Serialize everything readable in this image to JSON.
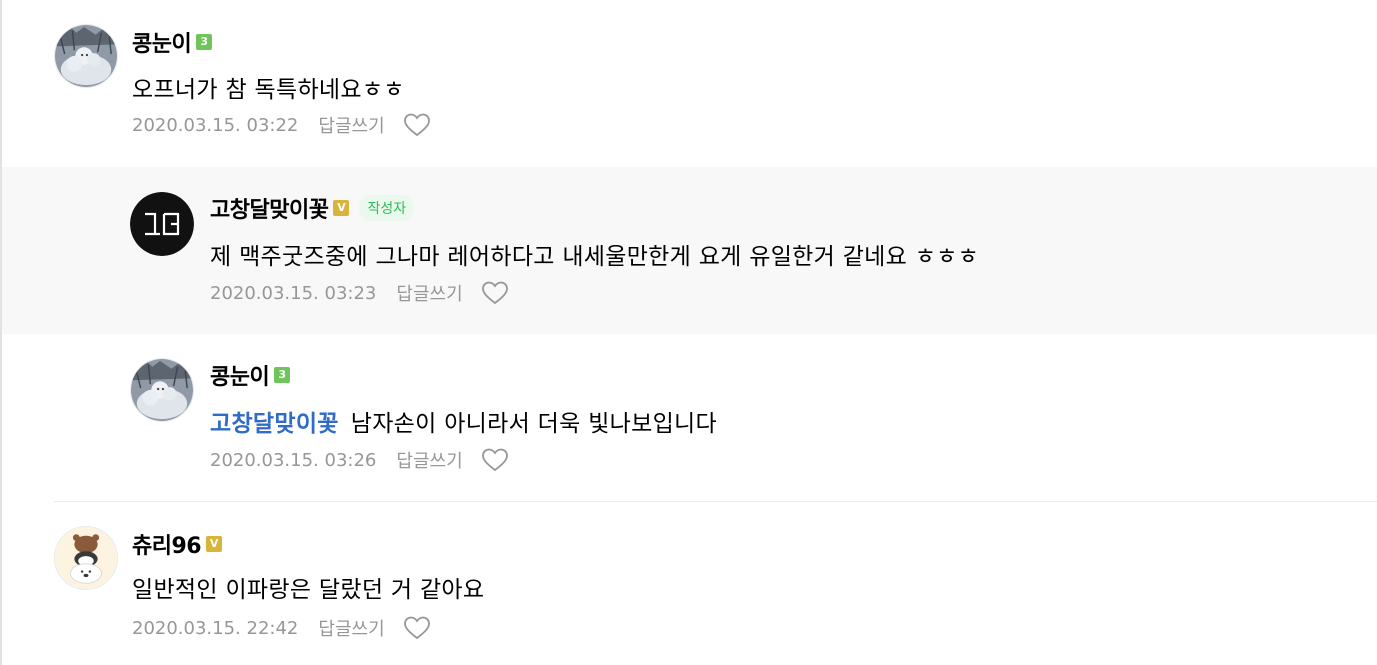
{
  "comments": [
    {
      "nickname": "콩눈이",
      "badge": "3",
      "badge_color": "#6fc45a",
      "avatar": "snowman-photo",
      "text": "오프너가 참 독특하네요ㅎㅎ",
      "timestamp": "2020.03.15. 03:22",
      "reply_label": "답글쓰기"
    },
    {
      "nickname": "고창달맞이꽃",
      "badge": "V",
      "badge_color": "#d8b43a",
      "author_tag": "작성자",
      "avatar": "gcd-logo",
      "avatar_text": "GD",
      "text": "제 맥주굿즈중에 그나마 레어하다고 내세울만한게 요게 유일한거 같네요 ㅎㅎㅎ",
      "timestamp": "2020.03.15. 03:23",
      "reply_label": "답글쓰기"
    },
    {
      "nickname": "콩눈이",
      "badge": "3",
      "badge_color": "#6fc45a",
      "avatar": "snowman-photo",
      "mention": "고창달맞이꽃",
      "text": "남자손이 아니라서 더욱 빛나보입니다",
      "timestamp": "2020.03.15. 03:26",
      "reply_label": "답글쓰기"
    },
    {
      "nickname": "츄리96",
      "badge": "V",
      "badge_color": "#d8b43a",
      "avatar": "bear-character",
      "text": "일반적인 이파랑은 달랐던 거 같아요",
      "timestamp": "2020.03.15. 22:42",
      "reply_label": "답글쓰기"
    }
  ],
  "colors": {
    "mention": "#2f6bc7",
    "author_tag_bg": "#eaf8ee",
    "author_tag_text": "#2ebd59",
    "meta": "#979797",
    "reply_bg": "#f8f8f8"
  }
}
